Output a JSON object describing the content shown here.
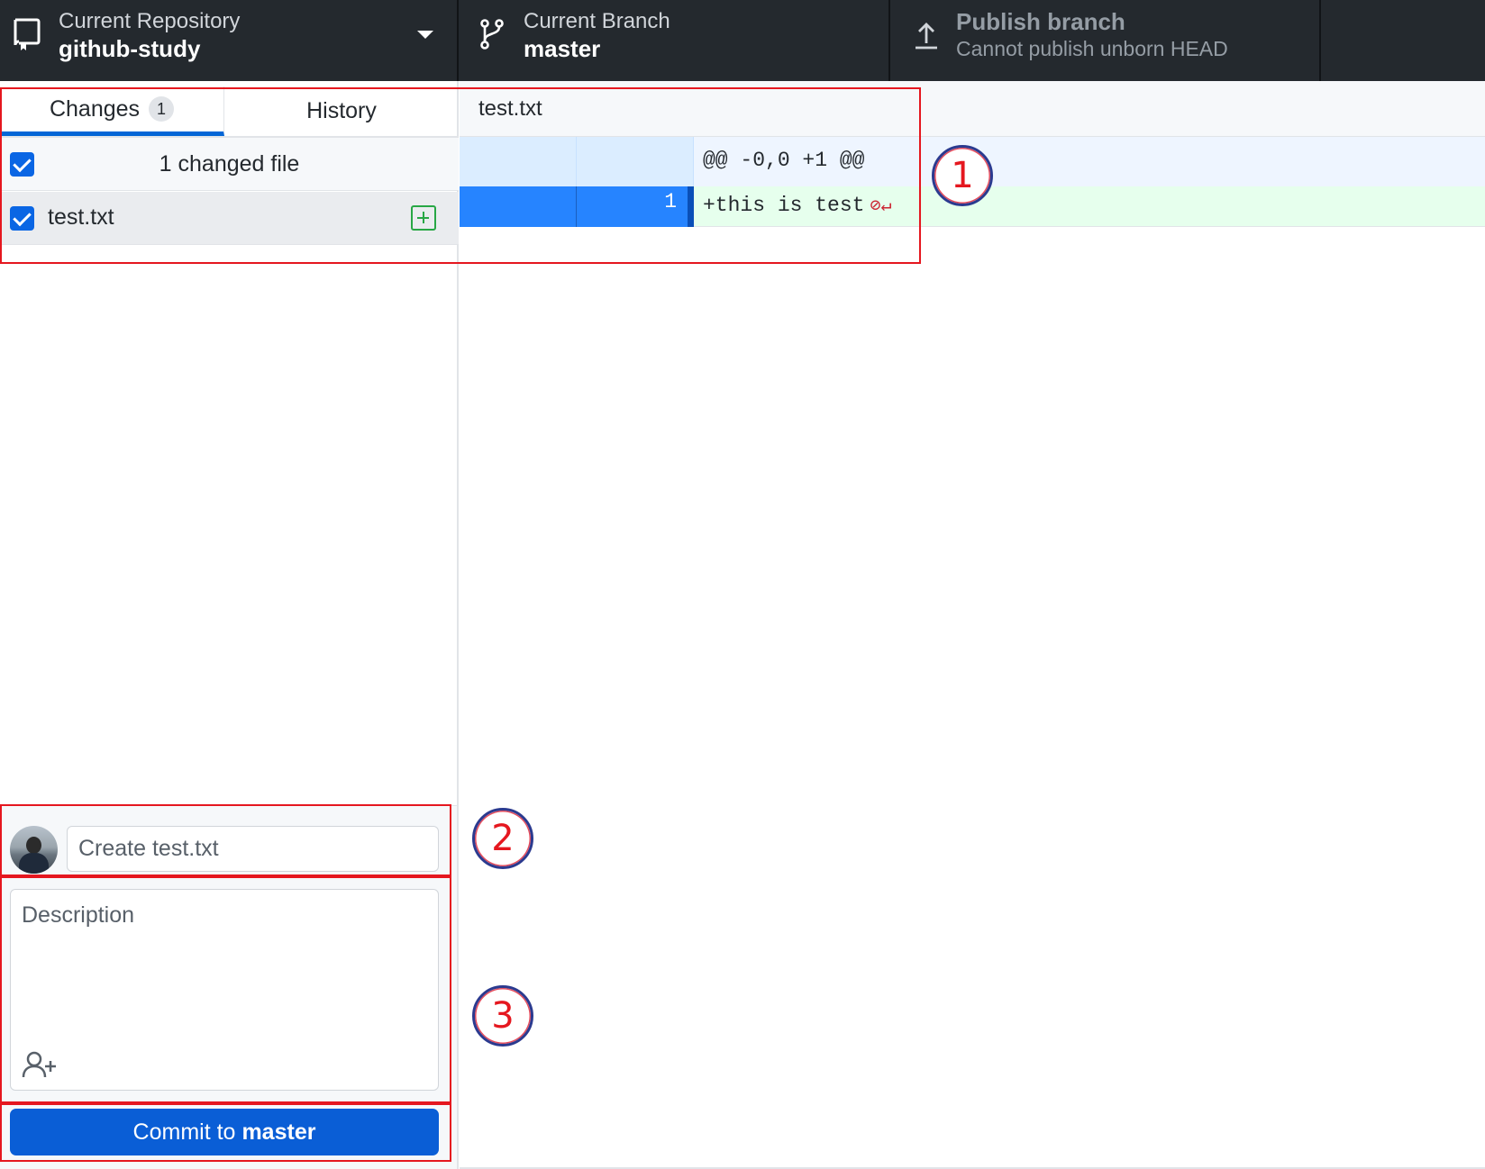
{
  "toolbar": {
    "repo": {
      "title": "Current Repository",
      "value": "github-study"
    },
    "branch": {
      "title": "Current Branch",
      "value": "master"
    },
    "publish": {
      "title": "Publish branch",
      "value": "Cannot publish unborn HEAD"
    }
  },
  "sidebar": {
    "tabs": [
      {
        "label": "Changes",
        "count": "1"
      },
      {
        "label": "History"
      }
    ],
    "changed_header": "1 changed file",
    "files": [
      {
        "name": "test.txt",
        "status": "added",
        "checked": true
      }
    ]
  },
  "commit": {
    "summary_placeholder": "Create test.txt",
    "description_placeholder": "Description",
    "button_prefix": "Commit to",
    "button_branch": "master"
  },
  "diff": {
    "file": "test.txt",
    "hunk_header": "@@ -0,0 +1 @@",
    "lines": [
      {
        "new_line_number": "1",
        "content": "+this is test",
        "no_newline_marker": "⊘↵"
      }
    ]
  },
  "annotations": [
    "1",
    "2",
    "3"
  ],
  "colors": {
    "toolbar_bg": "#24292e",
    "accent_blue": "#0a5ed6",
    "added_green": "#28a745",
    "annotation_red": "#e5171f"
  }
}
